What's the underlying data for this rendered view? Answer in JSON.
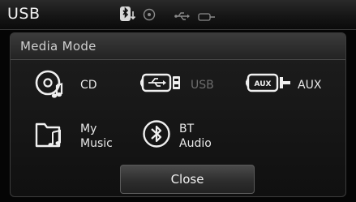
{
  "status": {
    "title": "USB",
    "icons": [
      "bluetooth-download-icon",
      "disc-icon",
      "usb-icon",
      "aux-icon"
    ]
  },
  "dialog": {
    "title": "Media Mode",
    "options": [
      {
        "id": "cd",
        "label": "CD",
        "icon": "cd-icon",
        "enabled": true
      },
      {
        "id": "usb",
        "label": "USB",
        "icon": "usb-icon",
        "enabled": false
      },
      {
        "id": "aux",
        "label": "AUX",
        "icon": "aux-icon",
        "enabled": true
      },
      {
        "id": "my_music",
        "label_line1": "My",
        "label_line2": "Music",
        "icon": "music-folder-icon",
        "enabled": true
      },
      {
        "id": "bt_audio",
        "label_line1": "BT",
        "label_line2": "Audio",
        "icon": "bluetooth-icon",
        "enabled": true
      }
    ],
    "close_label": "Close"
  },
  "colors": {
    "background": "#050505",
    "text": "#e6e6e6",
    "disabled_text": "#6e6e6e"
  }
}
